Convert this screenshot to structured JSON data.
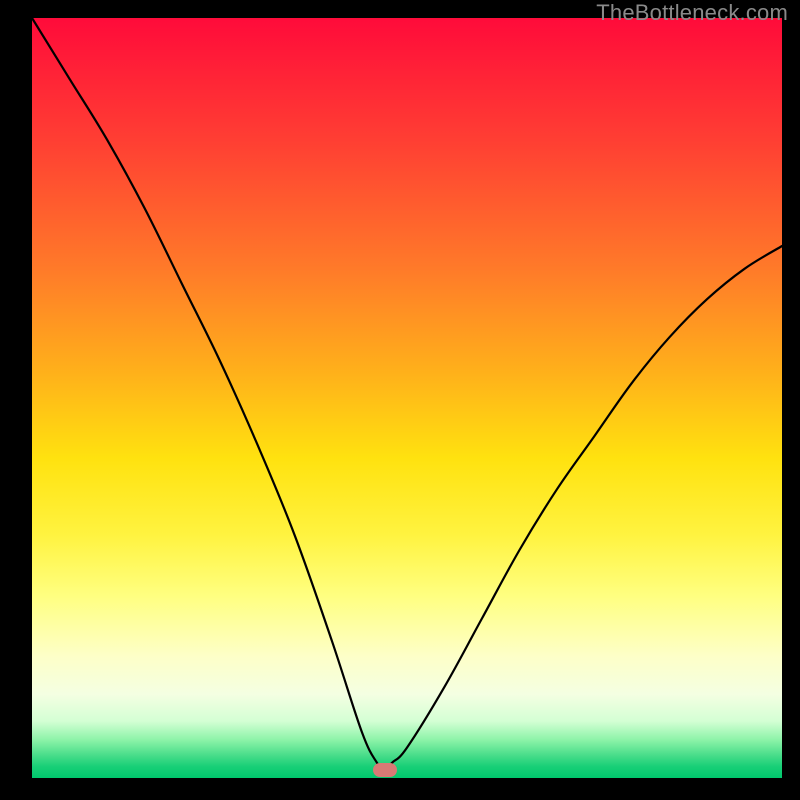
{
  "watermark": "TheBottleneck.com",
  "colors": {
    "curve": "#000000",
    "marker": "#d87a75",
    "gradient_top": "#ff0b3a",
    "gradient_bottom": "#00c76d",
    "frame": "#000000"
  },
  "chart_data": {
    "type": "line",
    "title": "",
    "xlabel": "",
    "ylabel": "",
    "xlim": [
      0,
      100
    ],
    "ylim": [
      0,
      100
    ],
    "grid": false,
    "legend": false,
    "description": "Bottleneck curve: percentage bottleneck (y, 0 at bottom = no bottleneck, 100 at top = severe) vs component balance parameter (x). Curve drops from top-left to a minimum near x≈47 then rises toward the right. Marker indicates the sweet-spot minimum.",
    "series": [
      {
        "name": "bottleneck",
        "x": [
          0,
          5,
          10,
          15,
          20,
          25,
          30,
          35,
          40,
          44,
          46,
          47,
          48,
          50,
          55,
          60,
          65,
          70,
          75,
          80,
          85,
          90,
          95,
          100
        ],
        "values": [
          100,
          92,
          84,
          75,
          65,
          55,
          44,
          32,
          18,
          6,
          2,
          1,
          2,
          4,
          12,
          21,
          30,
          38,
          45,
          52,
          58,
          63,
          67,
          70
        ]
      }
    ],
    "marker": {
      "x": 47,
      "y": 1
    }
  }
}
